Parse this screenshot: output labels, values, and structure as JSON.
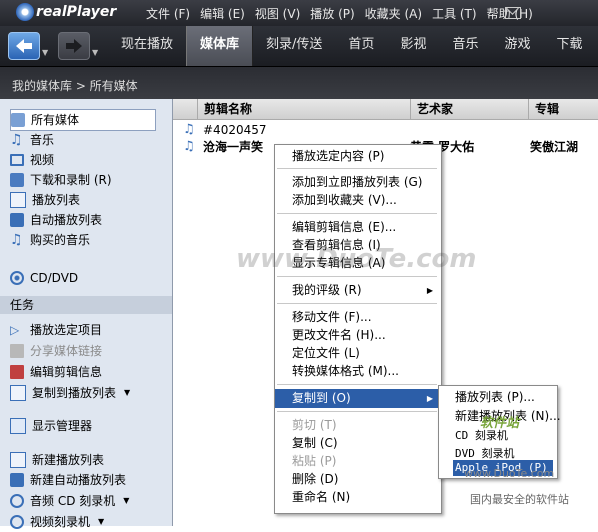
{
  "titlebar": {
    "logo": "realPlayer",
    "menu": [
      "文件 (F)",
      "编辑 (E)",
      "视图 (V)",
      "播放 (P)",
      "收藏夹 (A)",
      "工具 (T)",
      "帮助 (H)"
    ]
  },
  "nav": {
    "tabs": [
      "现在播放",
      "媒体库",
      "刻录/传送",
      "首页",
      "影视",
      "音乐",
      "游戏",
      "下载"
    ],
    "active_tab": "媒体库"
  },
  "breadcrumb": "我的媒体库 > 所有媒体",
  "sidebar": {
    "library": [
      "所有媒体",
      "音乐",
      "视频",
      "下载和录制 (R)",
      "播放列表",
      "自动播放列表",
      "购买的音乐"
    ],
    "cd": "CD/DVD",
    "task_header": "任务",
    "tasks": [
      "播放选定项目",
      "分享媒体链接",
      "编辑剪辑信息",
      "复制到播放列表",
      "显示管理器",
      "新建播放列表",
      "新建自动播放列表",
      "音频 CD 刻录机",
      "视频刻录机"
    ]
  },
  "table": {
    "headers": [
      "剪辑名称",
      "艺术家",
      "专辑"
    ],
    "rows": [
      {
        "name": "#4020457",
        "artist": "",
        "album": ""
      },
      {
        "name": "沧海一声笑",
        "artist": "黄霑 罗大佑",
        "album": "笑傲江湖"
      }
    ]
  },
  "context_menu": {
    "items": [
      "播放选定内容 (P)",
      "添加到立即播放列表 (G)",
      "添加到收藏夹 (V)...",
      "编辑剪辑信息 (E)...",
      "查看剪辑信息 (I)",
      "显示专辑信息 (A)",
      "我的评级 (R)",
      "移动文件 (F)...",
      "更改文件名 (H)...",
      "定位文件 (L)",
      "转换媒体格式 (M)...",
      "复制到 (O)",
      "剪切 (T)",
      "复制 (C)",
      "粘贴 (P)",
      "删除 (D)",
      "重命名 (N)"
    ]
  },
  "submenu": {
    "items": [
      "播放列表 (P)...",
      "新建播放列表 (N)...",
      "CD 刻录机",
      "DVD 刻录机",
      "Apple iPod (P)"
    ]
  },
  "watermarks": [
    "www.DuoTe.com",
    "软件站",
    "www.DuoTe.com",
    "国内最安全的软件站"
  ],
  "colors": {
    "accent": "#2c5ea8",
    "toolbar": "#2a2c32",
    "sidebar": "#dfe6f0"
  }
}
